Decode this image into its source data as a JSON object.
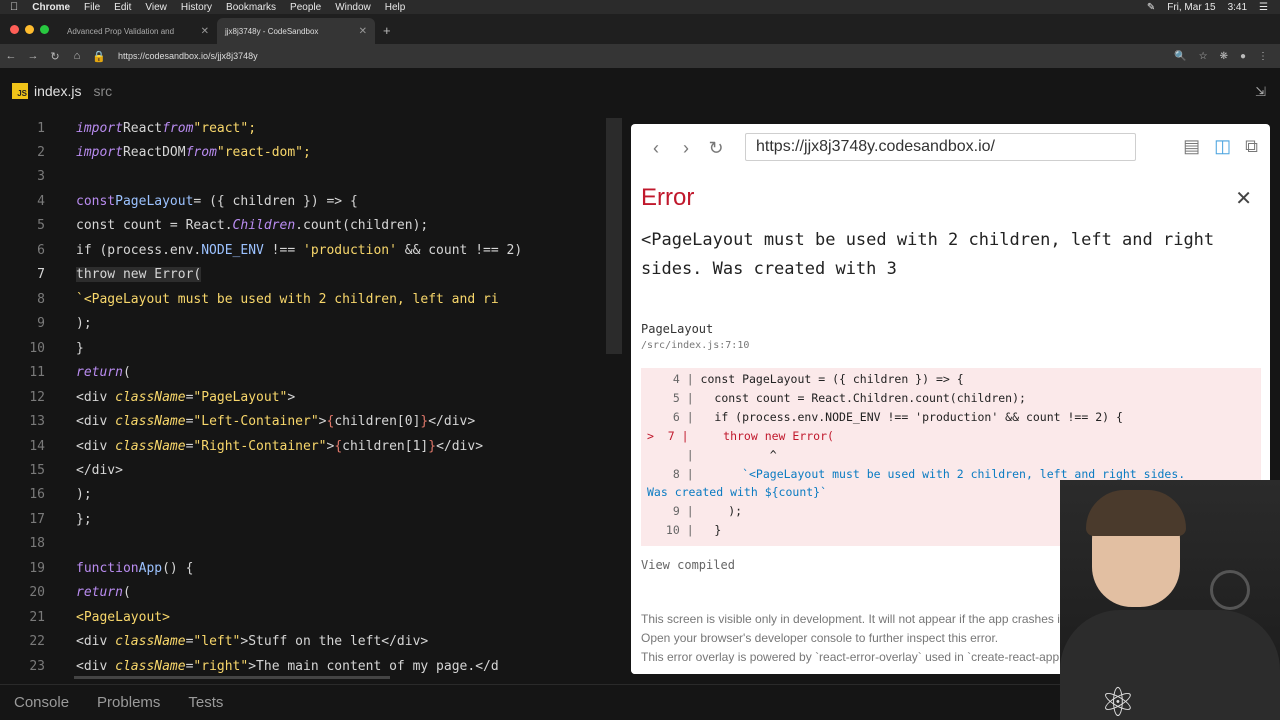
{
  "menubar": {
    "apple": "",
    "app": "Chrome",
    "items": [
      "File",
      "Edit",
      "View",
      "History",
      "Bookmarks",
      "People",
      "Window",
      "Help"
    ],
    "date": "Fri, Mar 15",
    "time": "3:41"
  },
  "tabs": [
    {
      "title": "Advanced Prop Validation and",
      "active": false
    },
    {
      "title": "jjx8j3748y - CodeSandbox",
      "active": true
    }
  ],
  "browser": {
    "url": "https://codesandbox.io/s/jjx8j3748y"
  },
  "ide": {
    "file_name": "index.js",
    "file_path": "src",
    "current_line": 7,
    "bottom_tabs": [
      "Console",
      "Problems",
      "Tests"
    ]
  },
  "code_lines": [
    {
      "n": "1"
    },
    {
      "n": "2"
    },
    {
      "n": "3"
    },
    {
      "n": "4"
    },
    {
      "n": "5"
    },
    {
      "n": "6"
    },
    {
      "n": "7"
    },
    {
      "n": "8"
    },
    {
      "n": "9"
    },
    {
      "n": "10"
    },
    {
      "n": "11"
    },
    {
      "n": "12"
    },
    {
      "n": "13"
    },
    {
      "n": "14"
    },
    {
      "n": "15"
    },
    {
      "n": "16"
    },
    {
      "n": "17"
    },
    {
      "n": "18"
    },
    {
      "n": "19"
    },
    {
      "n": "20"
    },
    {
      "n": "21"
    },
    {
      "n": "22"
    },
    {
      "n": "23"
    }
  ],
  "code": {
    "l1": [
      "import",
      "React",
      "from",
      "\"react\";"
    ],
    "l2": [
      "import",
      "ReactDOM",
      "from",
      "\"react-dom\";"
    ],
    "l4": [
      "const",
      "PageLayout",
      "= ({ children }) => {"
    ],
    "l5": [
      "const count = React.",
      "Children",
      ".count(children);"
    ],
    "l6": [
      "if (process.env.",
      "NODE_ENV",
      " !== ",
      "'production'",
      " && count !== 2)"
    ],
    "l7": [
      "throw new Error("
    ],
    "l8": [
      "`<PageLayout must be used with 2 children, left and ri"
    ],
    "l9": [
      ");"
    ],
    "l10": [
      "}"
    ],
    "l11": [
      "return",
      "("
    ],
    "l12": [
      "<div ",
      "className",
      "=",
      "\"PageLayout\"",
      ">"
    ],
    "l13": [
      "<div ",
      "className",
      "=",
      "\"Left-Container\"",
      ">",
      "{",
      "children[0]",
      "}",
      "</div>"
    ],
    "l14": [
      "<div ",
      "className",
      "=",
      "\"Right-Container\"",
      ">",
      "{",
      "children[1]",
      "}",
      "</div>"
    ],
    "l15": [
      "</div>"
    ],
    "l16": [
      ");"
    ],
    "l17": [
      "};"
    ],
    "l19": [
      "function",
      "App",
      "() {"
    ],
    "l20": [
      "return",
      "("
    ],
    "l21": [
      "<PageLayout>"
    ],
    "l22": [
      "<div ",
      "className",
      "=",
      "\"left\"",
      ">Stuff on the left</div>"
    ],
    "l23": [
      "<div ",
      "className",
      "=",
      "\"right\"",
      ">The main content of my page.</d"
    ]
  },
  "preview": {
    "url": "https://jjx8j3748y.codesandbox.io/",
    "error_title": "Error",
    "error_message": "<PageLayout must be used with 2 children, left and right sides. Was created with 3",
    "frame_name": "PageLayout",
    "frame_location": "/src/index.js:7:10",
    "code_lines": [
      {
        "prefix": "  4 | ",
        "code": "const PageLayout = ({ children }) => {"
      },
      {
        "prefix": "  5 | ",
        "code": "  const count = React.Children.count(children);"
      },
      {
        "prefix": "  6 | ",
        "code": "  if (process.env.NODE_ENV !== 'production' && count !== 2) {"
      },
      {
        "prefix": ">  7 | ",
        "code": "    throw new Error("
      },
      {
        "prefix": "    | ",
        "code": "          ^"
      },
      {
        "prefix": "  8 | ",
        "code": "      `<PageLayout must be used with 2 children, left and right sides."
      },
      {
        "prefix": "",
        "code": "Was created with ${count}`"
      },
      {
        "prefix": "  9 | ",
        "code": "    );"
      },
      {
        "prefix": " 10 | ",
        "code": "  }"
      }
    ],
    "view_compiled": "View compiled",
    "footer": [
      "This screen is visible only in development. It will not appear if the app crashes in production.",
      "Open your browser's developer console to further inspect this error.",
      "This error overlay is powered by `react-error-overlay` used in `create-react-app`."
    ]
  }
}
